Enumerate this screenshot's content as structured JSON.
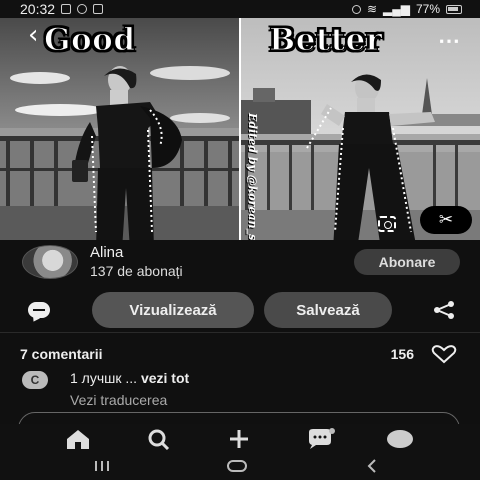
{
  "status_bar": {
    "time": "20:32",
    "battery_text": "77%"
  },
  "pin": {
    "left_title": "Good",
    "right_title": "Better",
    "watermark": "Edited by @korean_style_x"
  },
  "author": {
    "name": "Alina",
    "followers": "137 de abonați",
    "follow_label": "Abonare"
  },
  "actions": {
    "view_label": "Vizualizează",
    "save_label": "Salvează"
  },
  "comments": {
    "count_label": "7 comentarii",
    "likes": "156",
    "items": [
      {
        "avatar_letter": "C",
        "text": "1 лучшк ...",
        "more_label": "vezi tot",
        "translate_label": "Vezi traducerea"
      }
    ]
  },
  "icons": {
    "back": "back-arrow-icon",
    "more": "more-icon",
    "crop": "scissors-icon",
    "comment": "comment-icon",
    "share": "share-icon",
    "heart": "heart-icon",
    "home": "home-icon",
    "search": "search-icon",
    "create": "plus-icon",
    "messages": "chat-icon",
    "profile": "profile-icon"
  }
}
